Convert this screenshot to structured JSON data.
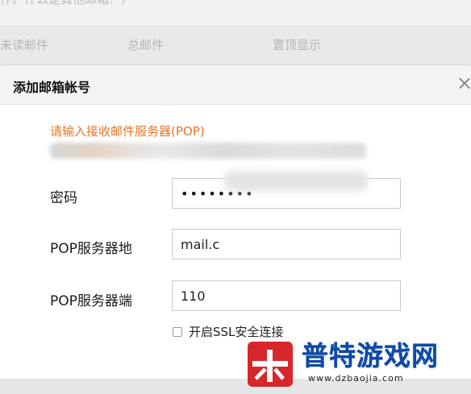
{
  "background": {
    "top_note": "件。什么是其他邮箱？）",
    "columns": [
      "未读邮件",
      "总邮件",
      "置顶显示"
    ]
  },
  "modal": {
    "title": "添加邮箱帐号",
    "close_icon": "close-icon",
    "hint": "请输入接收邮件服务器(POP)",
    "fields": {
      "password": {
        "label": "密码",
        "value": "••••••••"
      },
      "pop_server": {
        "label": "POP服务器地",
        "value": "mail.c"
      },
      "pop_port": {
        "label": "POP服务器端",
        "value": "110"
      }
    },
    "ssl_checkbox": {
      "label": "开启SSL安全连接",
      "checked": false
    }
  },
  "watermark": {
    "text": "普特游戏网",
    "url": "www.dzbaojia.com",
    "colors": {
      "primary": "#0f4aa5",
      "logo": "#d7262c"
    }
  },
  "colors": {
    "hint": "#e8742a",
    "modal_header": "#f4f4f4",
    "input_border": "#c9c9c9"
  }
}
